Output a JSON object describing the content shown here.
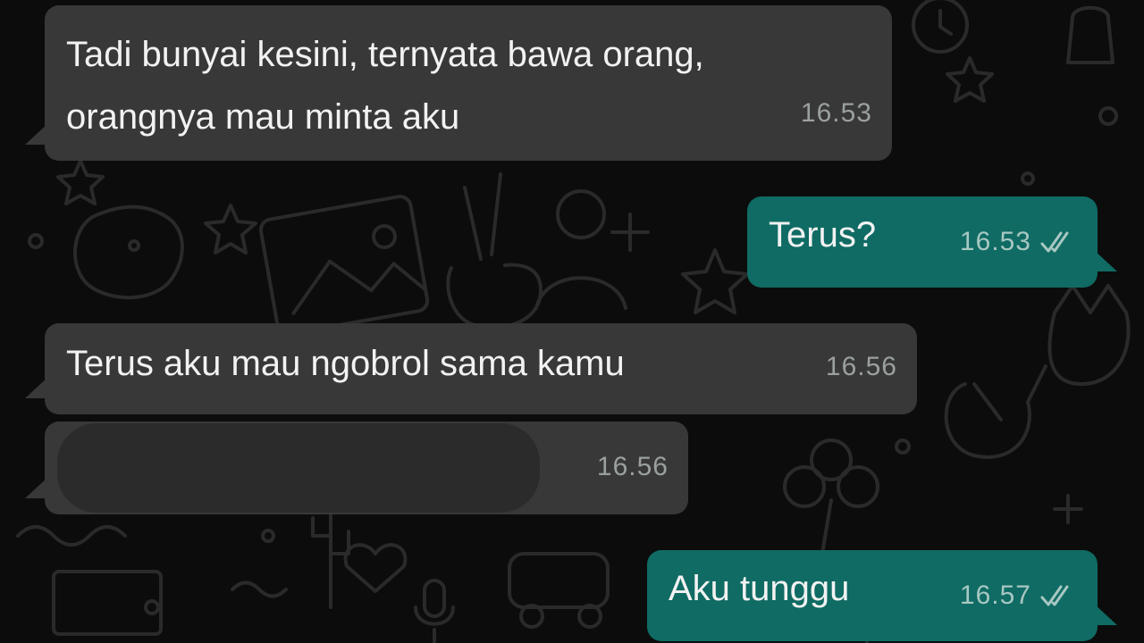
{
  "messages": [
    {
      "direction": "incoming",
      "text": "Tadi bunyai kesini, ternyata bawa orang,\norangnya mau minta aku",
      "time": "16.53"
    },
    {
      "direction": "outgoing",
      "text": "Terus?",
      "time": "16.53",
      "ticks": "read-double-check-icon"
    },
    {
      "direction": "incoming",
      "text": "Terus aku mau ngobrol sama kamu",
      "time": "16.56"
    },
    {
      "direction": "incoming",
      "text": "",
      "redacted": true,
      "time": "16.56"
    },
    {
      "direction": "outgoing",
      "text": "Aku tunggu",
      "time": "16.57",
      "ticks": "read-double-check-icon"
    }
  ],
  "colors": {
    "background": "#0c0c0c",
    "incoming_bubble": "#383838",
    "outgoing_bubble": "#0f6b63",
    "timestamp": "#9aa09e"
  }
}
